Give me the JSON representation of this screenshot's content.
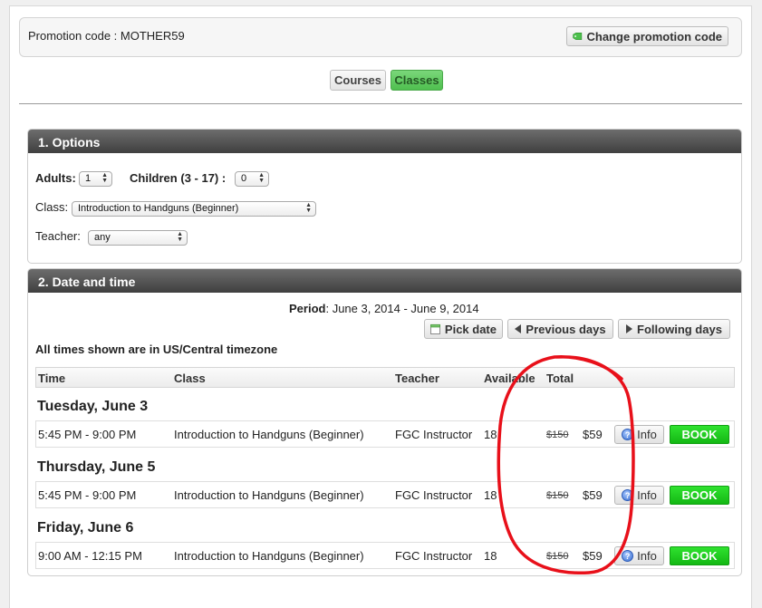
{
  "promotion": {
    "label": "Promotion code : MOTHER59",
    "change_button": "Change promotion code"
  },
  "view_toggle": {
    "courses": "Courses",
    "classes": "Classes",
    "active": "classes"
  },
  "options": {
    "heading": "1. Options",
    "adults_label": "Adults:",
    "adults_value": "1",
    "children_label": "Children",
    "children_range": "(3 - 17) :",
    "children_value": "0",
    "class_label": "Class:",
    "class_value": "Introduction to Handguns (Beginner)",
    "teacher_label": "Teacher:",
    "teacher_value": "any"
  },
  "datetime": {
    "heading": "2. Date and time",
    "period_label": "Period",
    "period_value": ": June 3, 2014 - June 9, 2014",
    "pick_date": "Pick date",
    "previous_days": "Previous days",
    "following_days": "Following days",
    "timezone_note": "All times shown are in US/Central timezone",
    "columns": [
      "Time",
      "Class",
      "Teacher",
      "Available",
      "Total"
    ],
    "days": [
      {
        "title": "Tuesday, June 3",
        "rows": [
          {
            "time": "5:45 PM - 9:00 PM",
            "class": "Introduction to Handguns (Beginner)",
            "teacher": "FGC Instructor",
            "available": "18",
            "old_price": "$150",
            "price": "$59",
            "info": "Info",
            "book": "BOOK"
          }
        ]
      },
      {
        "title": "Thursday, June 5",
        "rows": [
          {
            "time": "5:45 PM - 9:00 PM",
            "class": "Introduction to Handguns (Beginner)",
            "teacher": "FGC Instructor",
            "available": "18",
            "old_price": "$150",
            "price": "$59",
            "info": "Info",
            "book": "BOOK"
          }
        ]
      },
      {
        "title": "Friday, June 6",
        "rows": [
          {
            "time": "9:00 AM - 12:15 PM",
            "class": "Introduction to Handguns (Beginner)",
            "teacher": "FGC Instructor",
            "available": "18",
            "old_price": "$150",
            "price": "$59",
            "info": "Info",
            "book": "BOOK"
          }
        ]
      }
    ]
  },
  "colors": {
    "book_green": "#14b814",
    "active_toggle": "#4fbf4f",
    "panel_header": "#3f3f3f",
    "annotation_red": "#e8101a"
  },
  "icons": {
    "promo": "tag-icon",
    "pick_date": "calendar-icon",
    "previous": "triangle-left-icon",
    "following": "triangle-right-icon",
    "info": "question-icon"
  }
}
